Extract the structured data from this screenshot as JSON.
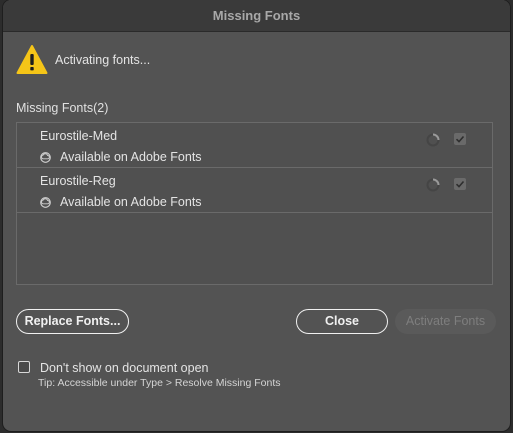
{
  "window": {
    "title": "Missing Fonts"
  },
  "status": {
    "icon": "warning-icon",
    "text": "Activating fonts..."
  },
  "missing_fonts": {
    "label": "Missing Fonts(2)",
    "items": [
      {
        "name": "Eurostile-Med",
        "availability": "Available on Adobe Fonts",
        "icon": "creative-cloud-icon",
        "checked": true
      },
      {
        "name": "Eurostile-Reg",
        "availability": "Available on Adobe Fonts",
        "icon": "creative-cloud-icon",
        "checked": true
      }
    ]
  },
  "buttons": {
    "replace": "Replace Fonts...",
    "close": "Close",
    "activate": "Activate Fonts"
  },
  "footer": {
    "dont_show_label": "Don't show on document open",
    "dont_show_checked": false,
    "tip": "Tip: Accessible under Type > Resolve Missing Fonts"
  },
  "colors": {
    "dialog_bg": "#535353",
    "titlebar_bg": "#3a3a3a",
    "warning_yellow": "#f5c518"
  }
}
